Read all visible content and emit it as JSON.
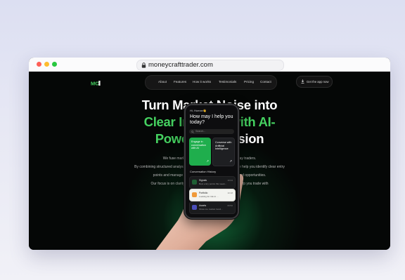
{
  "browser": {
    "url": "moneycrafttrader.com"
  },
  "site": {
    "logo_text": "MC",
    "nav": {
      "items": [
        "About",
        "Features",
        "How it works",
        "Testimonials",
        "Pricing",
        "Contact"
      ]
    },
    "cta_label": "Get the app now",
    "hero": {
      "line1": "Turn Market Noise into",
      "line2_white": "Clear Insights with ",
      "line2_green": "AI-",
      "line3_green": "Powered",
      "line3_white": " Decision"
    },
    "subtext": [
      "We fuse market data, news and AI to help everyday traders.",
      "By combining structured analysis with a conversational assistant, we help you identify clear entry",
      "points and manage risk across your portfolio of assets and opportunities.",
      "Our focus is on clarity: cutting through market noise and help you trade with"
    ]
  },
  "phone": {
    "status": "Hi, Human👋",
    "question": "How may I help you today?",
    "search_placeholder": "Search...",
    "cards": [
      {
        "label": "Engage in conversation with AI",
        "arrow": "↗"
      },
      {
        "label": "Converse with Artificial Intelligence",
        "arrow": "↗"
      }
    ],
    "history_title": "Conversation History",
    "history": [
      {
        "title": "Signals",
        "snippet": "Best entry points this week...",
        "time": "10:24"
      },
      {
        "title": "Portfolio",
        "snippet": "Looking for risk in ...",
        "time": "10:18"
      },
      {
        "title": "Assets",
        "snippet": "Show me market trend...",
        "time": "09:52"
      }
    ]
  },
  "colors": {
    "accent_green": "#45d160",
    "card_green": "#1fae4d",
    "background_dark": "#050706"
  },
  "icons": {
    "lock": "lock-icon",
    "download": "download-icon",
    "search": "search-icon"
  }
}
